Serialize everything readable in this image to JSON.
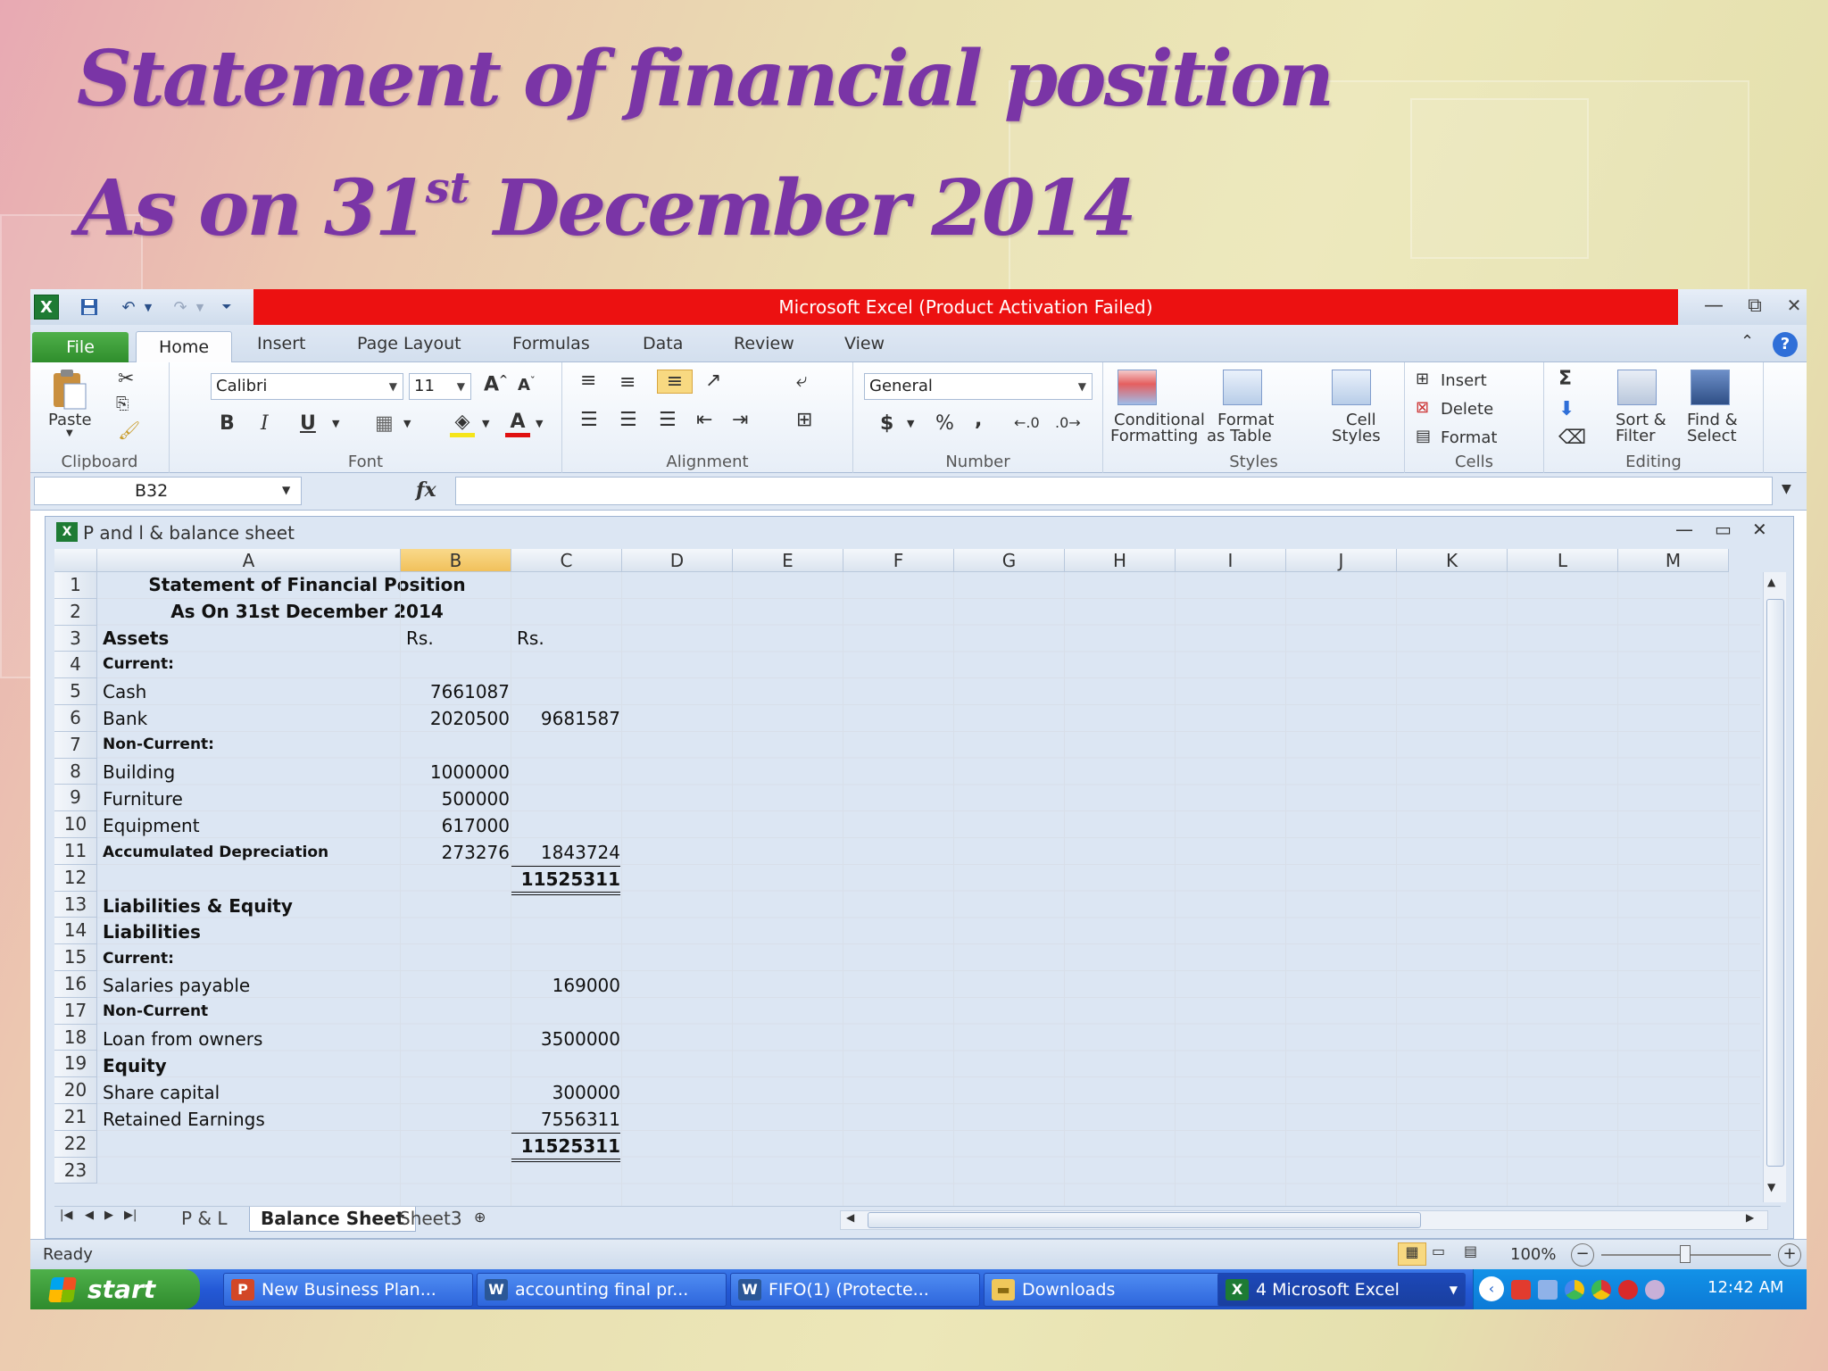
{
  "slide": {
    "title_line1": "Statement of financial position",
    "title_line2_pre": "As on 31",
    "title_line2_sup": "st",
    "title_line2_post": " December  2014"
  },
  "window": {
    "title": "Microsoft Excel (Product Activation Failed)",
    "minimize": "—",
    "restore": "⧉",
    "close": "✕"
  },
  "tabs": [
    "File",
    "Home",
    "Insert",
    "Page Layout",
    "Formulas",
    "Data",
    "Review",
    "View"
  ],
  "ribbon": {
    "clipboard": {
      "paste": "Paste",
      "label": "Clipboard"
    },
    "font": {
      "name": "Calibri",
      "size": "11",
      "bold": "B",
      "italic": "I",
      "underline": "U",
      "label": "Font"
    },
    "alignment": {
      "label": "Alignment"
    },
    "number": {
      "format": "General",
      "currency": "$",
      "percent": "%",
      "comma": ",",
      "label": "Number"
    },
    "styles": {
      "conditional_1": "Conditional",
      "conditional_2": "Formatting",
      "format_table_1": "Format",
      "format_table_2": "as Table",
      "cell_styles_1": "Cell",
      "cell_styles_2": "Styles",
      "label": "Styles"
    },
    "cells": {
      "insert": "Insert",
      "delete": "Delete",
      "format": "Format",
      "label": "Cells"
    },
    "editing": {
      "sigma": "Σ",
      "sort_1": "Sort &",
      "sort_2": "Filter",
      "find_1": "Find &",
      "find_2": "Select",
      "label": "Editing"
    }
  },
  "formula_bar": {
    "name_box": "B32",
    "fx": "fx",
    "value": ""
  },
  "workbook": {
    "title": "P and l & balance sheet"
  },
  "columns": [
    "A",
    "B",
    "C",
    "D",
    "E",
    "F",
    "G",
    "H",
    "I",
    "J",
    "K",
    "L",
    "M"
  ],
  "selected_column": "B",
  "rows": [
    "1",
    "2",
    "3",
    "4",
    "5",
    "6",
    "7",
    "8",
    "9",
    "10",
    "11",
    "12",
    "13",
    "14",
    "15",
    "16",
    "17",
    "18",
    "19",
    "20",
    "21",
    "22",
    "23"
  ],
  "sheet": {
    "r1_a": "Statement of Financial Position",
    "r2_a": "As On 31st December 2014",
    "r3_a": "Assets",
    "r3_b": "Rs.",
    "r3_c": "Rs.",
    "r4_a": "Current:",
    "r5_a": "Cash",
    "r5_b": "7661087",
    "r6_a": "Bank",
    "r6_b": "2020500",
    "r6_c": "9681587",
    "r7_a": "Non-Current:",
    "r8_a": "Building",
    "r8_b": "1000000",
    "r9_a": "Furniture",
    "r9_b": "500000",
    "r10_a": "Equipment",
    "r10_b": "617000",
    "r11_a": "Accumulated Depreciation",
    "r11_b": "273276",
    "r11_c": "1843724",
    "r12_c": "11525311",
    "r13_a": "Liabilities & Equity",
    "r14_a": "Liabilities",
    "r15_a": "Current:",
    "r16_a": "Salaries payable",
    "r16_c": "169000",
    "r17_a": "Non-Current",
    "r18_a": "Loan from owners",
    "r18_c": "3500000",
    "r19_a": "Equity",
    "r20_a": "Share capital",
    "r20_c": "300000",
    "r21_a": "Retained Earnings",
    "r21_c": "7556311",
    "r22_c": "11525311"
  },
  "sheet_tabs": [
    "P & L",
    "Balance Sheet",
    "Sheet3"
  ],
  "active_sheet": "Balance Sheet",
  "status": {
    "ready": "Ready",
    "zoom": "100%"
  },
  "taskbar": {
    "start": "start",
    "items": [
      "New Business Plan...",
      "accounting final pr...",
      "FIFO(1) (Protecte...",
      "Downloads",
      "4  Microsoft Excel"
    ],
    "clock": "12:42 AM"
  }
}
